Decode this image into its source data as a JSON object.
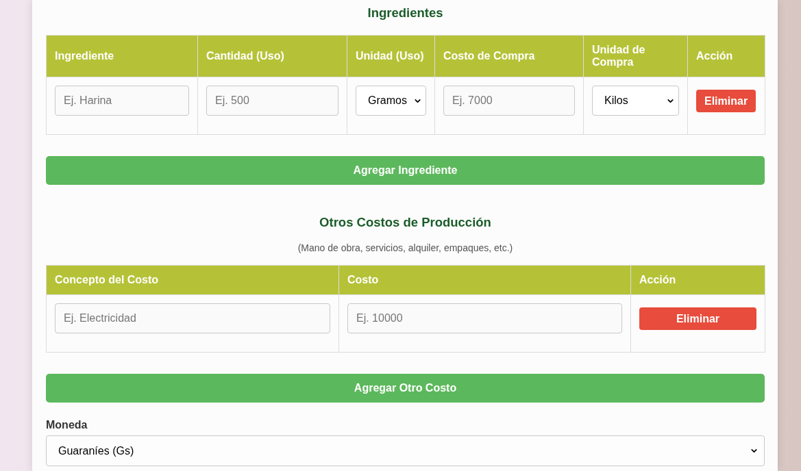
{
  "ingredients": {
    "title": "Ingredientes",
    "columns": [
      "Ingrediente",
      "Cantidad (Uso)",
      "Unidad (Uso)",
      "Costo de Compra",
      "Unidad de Compra",
      "Acción"
    ],
    "rows": [
      {
        "cells": [
          {
            "kind": "input",
            "placeholder": "Ej. Harina"
          },
          {
            "kind": "input",
            "placeholder": "Ej. 500"
          },
          {
            "kind": "select",
            "value": "Gramos"
          },
          {
            "kind": "input",
            "placeholder": "Ej. 7000"
          },
          {
            "kind": "select",
            "value": "Kilos"
          },
          {
            "kind": "button",
            "label": "Eliminar"
          }
        ]
      }
    ],
    "add_button": "Agregar Ingrediente"
  },
  "other_costs": {
    "title": "Otros Costos de Producción",
    "subtitle": "(Mano de obra, servicios, alquiler, empaques, etc.)",
    "columns": [
      "Concepto del Costo",
      "Costo",
      "Acción"
    ],
    "rows": [
      {
        "cells": [
          {
            "kind": "input",
            "placeholder": "Ej. Electricidad"
          },
          {
            "kind": "input",
            "placeholder": "Ej. 10000"
          },
          {
            "kind": "button",
            "label": "Eliminar"
          }
        ]
      }
    ],
    "add_button": "Agregar Otro Costo"
  },
  "currency": {
    "label": "Moneda",
    "value": "Guaraníes (Gs)"
  }
}
